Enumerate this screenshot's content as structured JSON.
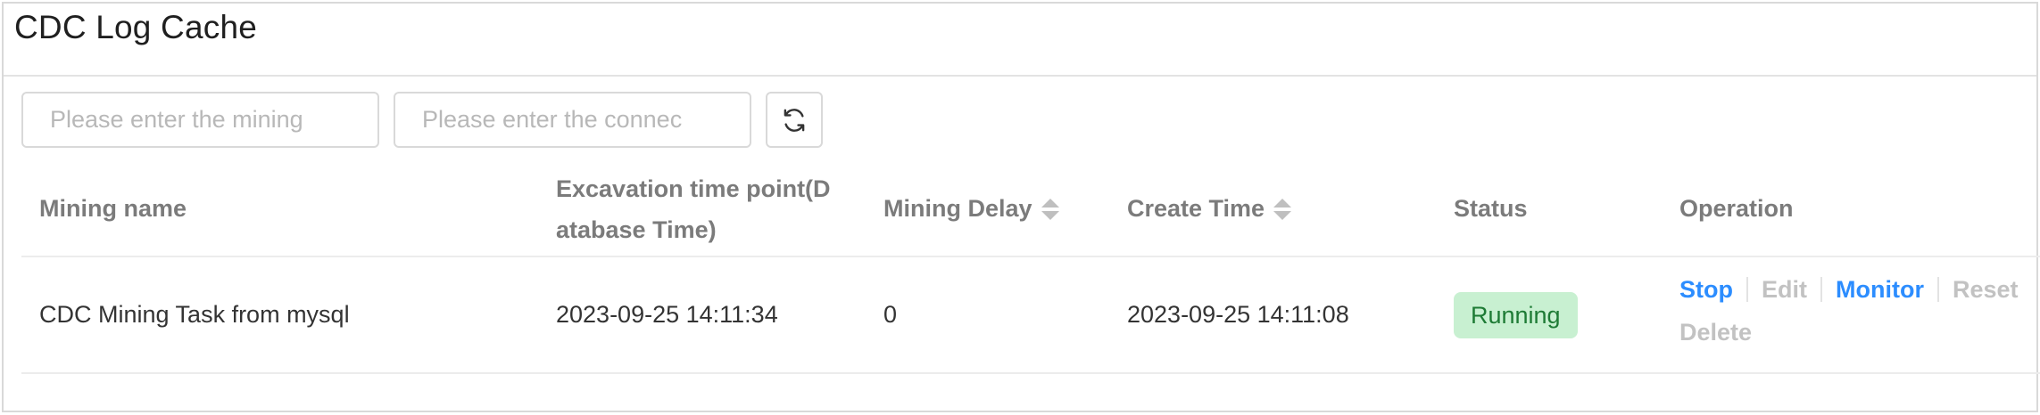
{
  "page": {
    "title": "CDC Log Cache"
  },
  "toolbar": {
    "mining_search_placeholder": "Please enter the mining",
    "connection_search_placeholder": "Please enter the connec",
    "refresh_icon": "refresh-icon"
  },
  "table": {
    "columns": {
      "mining_name": "Mining name",
      "excavation_line1": "Excavation time point(D",
      "excavation_line2": "atabase Time)",
      "mining_delay": "Mining Delay",
      "create_time": "Create Time",
      "status": "Status",
      "operation": "Operation"
    },
    "rows": [
      {
        "mining_name": "CDC Mining Task from mysql",
        "excavation_time": "2023-09-25 14:11:34",
        "mining_delay": "0",
        "create_time": "2023-09-25 14:11:08",
        "status": "Running",
        "operations": {
          "stop": "Stop",
          "edit": "Edit",
          "monitor": "Monitor",
          "reset": "Reset",
          "delete": "Delete"
        }
      }
    ]
  },
  "colors": {
    "link": "#2c8dff",
    "disabled_link": "#c2c2c2",
    "status_running_bg": "#c8f0d1",
    "status_running_text": "#1e7b35"
  }
}
